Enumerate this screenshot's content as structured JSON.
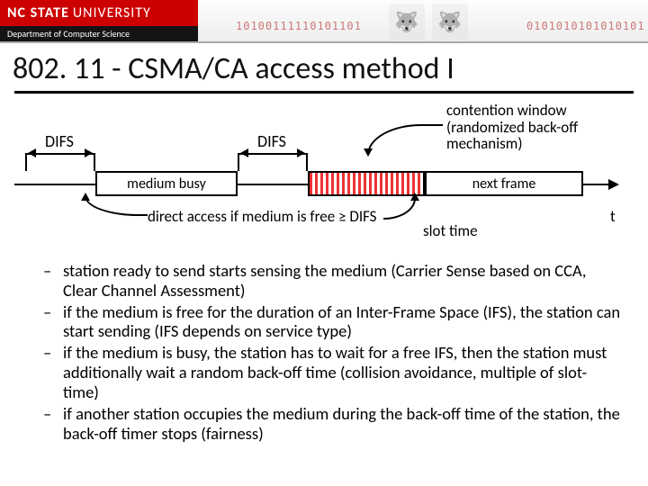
{
  "banner": {
    "brand_bold": "NC STATE",
    "brand_thin": "UNIVERSITY",
    "department": "Department of Computer Science",
    "bits1": "10100111110101101",
    "bits2": "0101010101010101"
  },
  "title": "802. 11 - CSMA/CA access method I",
  "diagram": {
    "difs1": "DIFS",
    "difs2": "DIFS",
    "contention_window": "contention window (randomized back-off mechanism)",
    "medium_busy": "medium busy",
    "next_frame": "next frame",
    "direct_access": "direct access if medium is free ≥ DIFS",
    "slot_time": "slot time",
    "t": "t"
  },
  "bullets": [
    "station ready to send starts sensing the medium (Carrier Sense based on CCA, Clear Channel Assessment)",
    "if the medium is free for the duration of an Inter-Frame Space (IFS), the station can start sending (IFS depends on service type)",
    "if the medium is busy, the station has to wait for a free IFS, then the station must additionally wait a random back-off time (collision avoidance, multiple of slot-time)",
    "if another station occupies the medium during the back-off time of the station, the back-off timer stops (fairness)"
  ]
}
